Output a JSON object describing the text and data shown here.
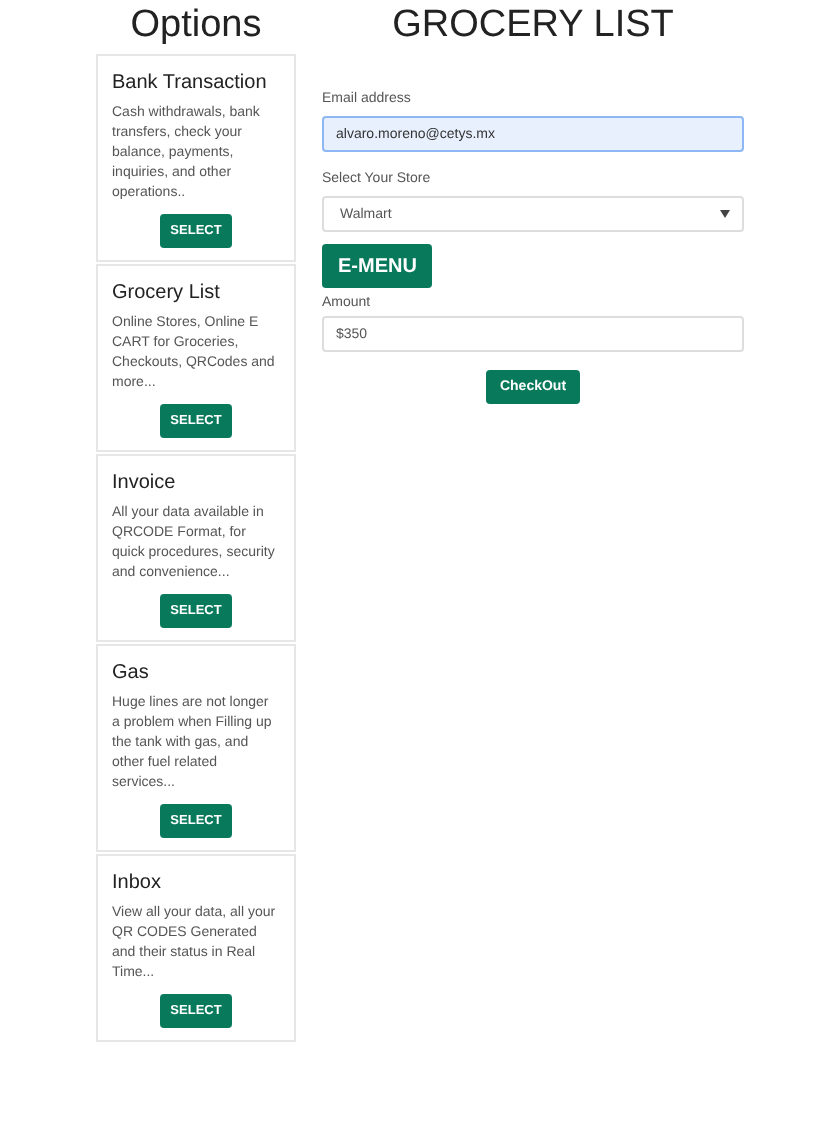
{
  "sidebar": {
    "title": "Options",
    "cards": [
      {
        "title": "Bank Transaction",
        "text": "Cash withdrawals, bank transfers, check your balance, payments, inquiries, and other operations..",
        "button": "SELECT"
      },
      {
        "title": "Grocery List",
        "text": "Online Stores, Online E CART for Groceries, Checkouts, QRCodes and more...",
        "button": "SELECT"
      },
      {
        "title": "Invoice",
        "text": "All your data available in QRCODE Format, for quick procedures, security and convenience...",
        "button": "SELECT"
      },
      {
        "title": "Gas",
        "text": "Huge lines are not longer a problem when Filling up the tank with gas, and other fuel related services...",
        "button": "SELECT"
      },
      {
        "title": "Inbox",
        "text": "View all your data, all your QR CODES Generated and their status in Real Time...",
        "button": "SELECT"
      }
    ]
  },
  "main": {
    "title": "GROCERY LIST",
    "email": {
      "label": "Email address",
      "value": "alvaro.moreno@cetys.mx",
      "focused": true
    },
    "store": {
      "label": "Select Your Store",
      "value": "Walmart"
    },
    "menu_button": "E-MENU",
    "amount": {
      "label": "Amount",
      "value": "$350"
    },
    "checkout_button": "CheckOut"
  }
}
